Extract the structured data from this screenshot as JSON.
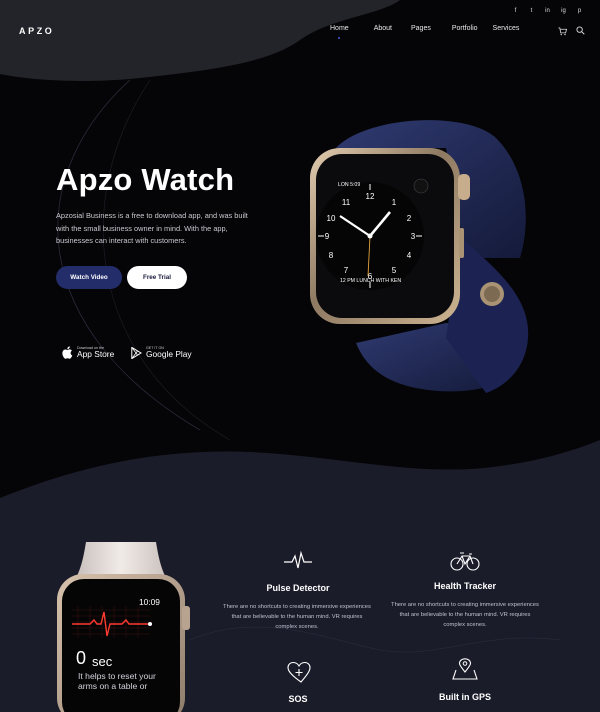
{
  "header": {
    "logo": "APZO",
    "nav": [
      {
        "label": "Home",
        "active": true
      },
      {
        "label": "About"
      },
      {
        "label": "Pages"
      },
      {
        "label": "Portfolio"
      },
      {
        "label": "Services"
      }
    ],
    "social": [
      "f",
      "t",
      "in",
      "ig",
      "p"
    ]
  },
  "hero": {
    "title": "Apzo Watch",
    "description": "Apzosial Business is a free to download app, and was built with the small business owner in mind. With the app, businesses can interact with customers.",
    "watch_video": "Watch Video",
    "free_trial": "Free Trial",
    "app_store_small": "Download on the",
    "app_store_big": "App Store",
    "google_play_small": "GET IT ON",
    "google_play_big": "Google Play",
    "watch_date": "LON 5:09",
    "watch_event": "12 PM LUNCH WITH KEN"
  },
  "second_watch": {
    "time": "10:09",
    "seconds_value": "0",
    "seconds_unit": "sec",
    "help": "It helps to reset your arms on a table or"
  },
  "features": [
    {
      "icon": "pulse-icon",
      "title": "Pulse Detector",
      "description": "There are no shortcuts to creating immersive experiences that are believable to the human mind. VR requires complex scenes."
    },
    {
      "icon": "bicycle-icon",
      "title": "Health Tracker",
      "description": "There are no shortcuts to creating immersive experiences that are believable to the human mind. VR requires complex scenes."
    },
    {
      "icon": "heart-plus-icon",
      "title": "SOS",
      "description": ""
    },
    {
      "icon": "map-pin-icon",
      "title": "Built in GPS",
      "description": ""
    }
  ],
  "colors": {
    "background": "#050507",
    "section_bg": "#1b1c2a",
    "accent": "#232d6a",
    "nav_dot": "#4a5bd8"
  }
}
